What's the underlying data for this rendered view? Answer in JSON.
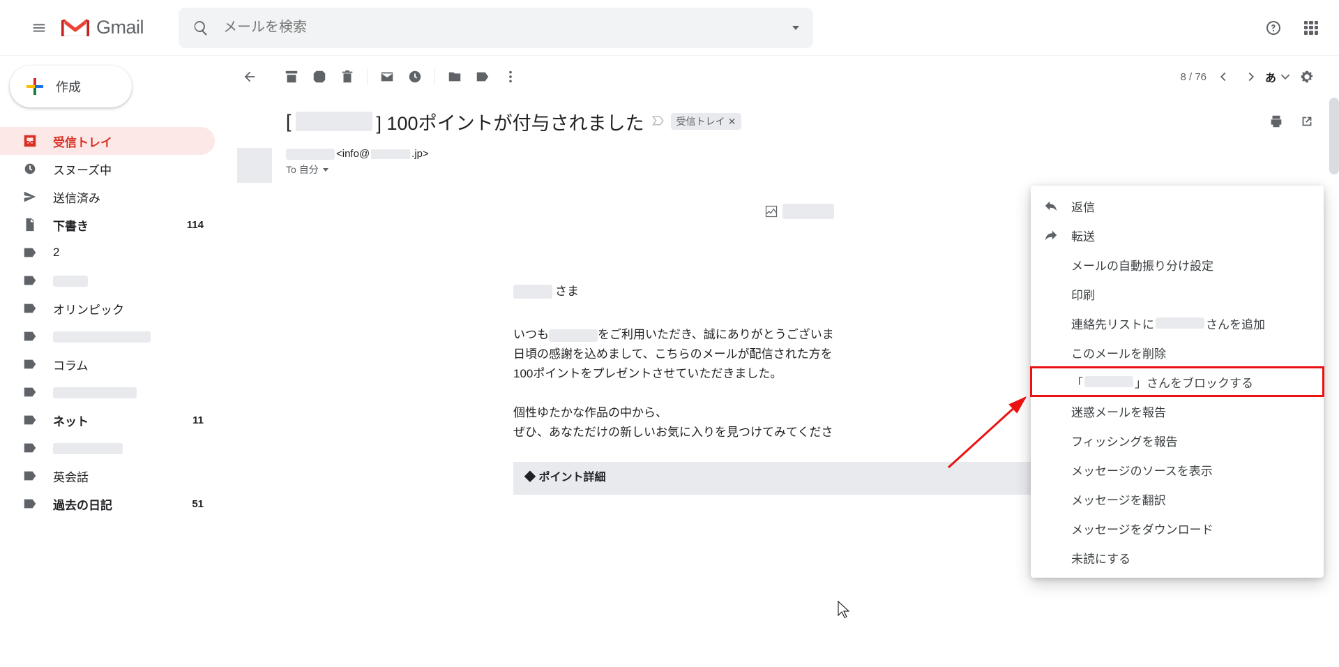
{
  "app_name": "Gmail",
  "search": {
    "placeholder": "メールを検索"
  },
  "compose_label": "作成",
  "sidebar": {
    "items": [
      {
        "label": "受信トレイ",
        "count": ""
      },
      {
        "label": "スヌーズ中",
        "count": ""
      },
      {
        "label": "送信済み",
        "count": ""
      },
      {
        "label": "下書き",
        "count": "114"
      },
      {
        "label": "2",
        "count": ""
      },
      {
        "label": "",
        "count": ""
      },
      {
        "label": "オリンピック",
        "count": ""
      },
      {
        "label": "",
        "count": ""
      },
      {
        "label": "コラム",
        "count": ""
      },
      {
        "label": "",
        "count": ""
      },
      {
        "label": "ネット",
        "count": "11"
      },
      {
        "label": "",
        "count": ""
      },
      {
        "label": "英会話",
        "count": ""
      },
      {
        "label": "過去の日記",
        "count": "51"
      }
    ]
  },
  "pager": "8 / 76",
  "ime": "あ",
  "subject_prefix": "[",
  "subject_suffix": "] 100ポイントが付与されました",
  "inbox_chip": "受信トレイ",
  "sender": {
    "email_prefix": "<info@",
    "email_suffix": ".jp>",
    "to_prefix": "To ",
    "to_value": "自分"
  },
  "body": {
    "greet_suffix": "さま",
    "p1a": "いつも",
    "p1b": "をご利用いただき、誠にありがとうございま",
    "p2": "日頃の感謝を込めまして、こちらのメールが配信された方を",
    "p3": "100ポイントをプレゼントさせていただきました。",
    "p4": "個性ゆたかな作品の中から、",
    "p5": "ぜひ、あなただけの新しいお気に入りを見つけてみてくださ",
    "detail_header": "◆ ポイント詳細"
  },
  "menu": {
    "reply": "返信",
    "forward": "転送",
    "filter": "メールの自動振り分け設定",
    "print": "印刷",
    "add_contact_prefix": "連絡先リストに",
    "add_contact_suffix": "さんを追加",
    "delete": "このメールを削除",
    "block_prefix": "「",
    "block_suffix": "」さんをブロックする",
    "spam": "迷惑メールを報告",
    "phishing": "フィッシングを報告",
    "source": "メッセージのソースを表示",
    "translate": "メッセージを翻訳",
    "download": "メッセージをダウンロード",
    "unread": "未読にする"
  }
}
